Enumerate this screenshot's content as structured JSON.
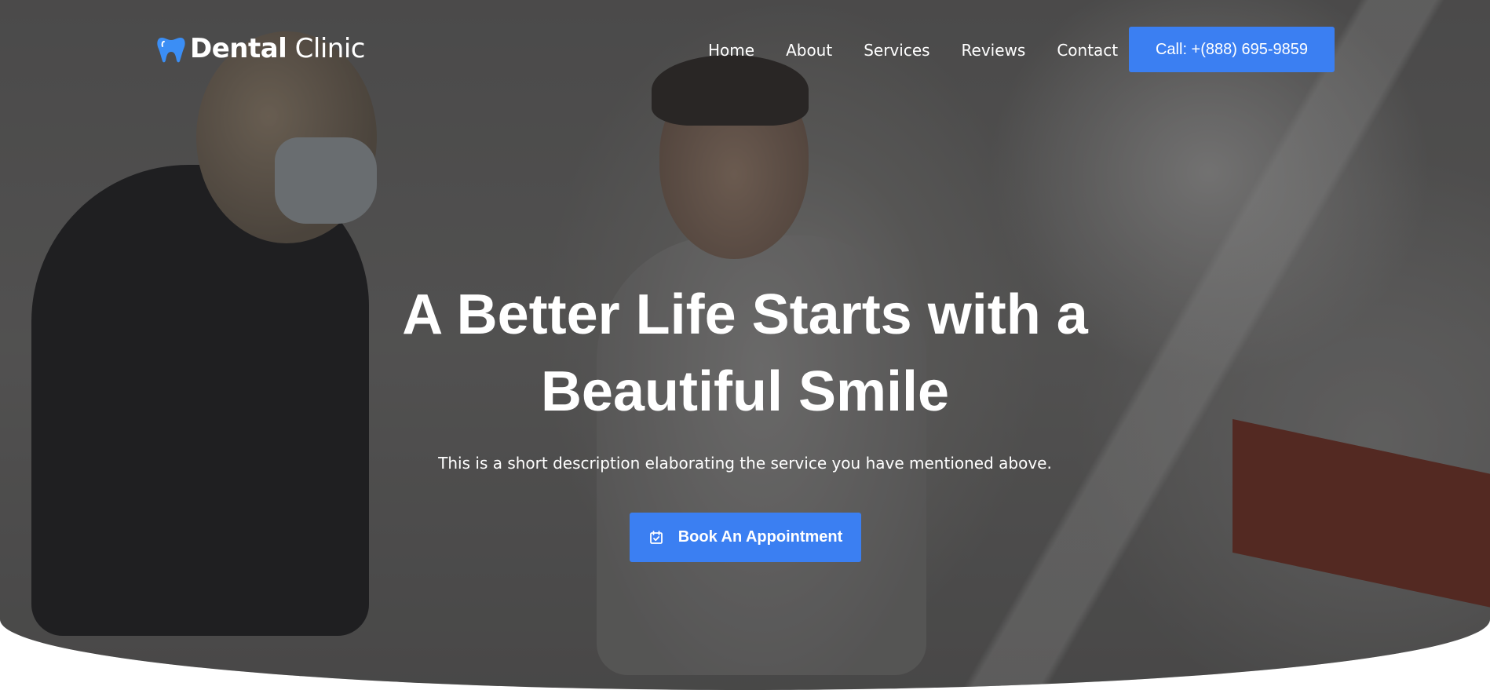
{
  "brand": {
    "name_bold": "Dental",
    "name_light": "Clinic",
    "logo_icon": "tooth-icon",
    "accent_color": "#3b7ff2"
  },
  "nav": {
    "items": [
      {
        "label": "Home"
      },
      {
        "label": "About"
      },
      {
        "label": "Services"
      },
      {
        "label": "Reviews"
      },
      {
        "label": "Contact"
      }
    ]
  },
  "header": {
    "call_label": "Call: +(888) 695-9859"
  },
  "hero": {
    "headline_line1": "A Better Life Starts with a",
    "headline_line2": "Beautiful Smile",
    "description": "This is a short description elaborating the service you have mentioned above.",
    "cta_label": "Book An Appointment",
    "cta_icon": "calendar-check-icon"
  }
}
